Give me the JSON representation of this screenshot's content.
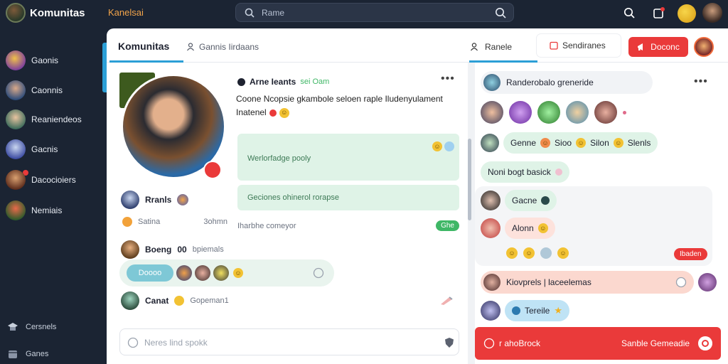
{
  "topbar": {
    "app_name": "Komunitas",
    "subtitle": "Kanelsai",
    "search_value": "Rame"
  },
  "sidebar": {
    "items": [
      {
        "label": "Gaonis"
      },
      {
        "label": "Caonnis"
      },
      {
        "label": "Reaniendeos"
      },
      {
        "label": "Gacnis"
      },
      {
        "label": "Dacocioiers"
      },
      {
        "label": "Nemiais"
      }
    ],
    "footer": [
      {
        "label": "Cersnels",
        "icon": "graduation-cap-icon"
      },
      {
        "label": "Ganes",
        "icon": "box-icon"
      }
    ]
  },
  "tabs": {
    "main": "Komunitas",
    "second": "Gannis Iirdaans",
    "third": "Ranele",
    "fourth": "Sendiranes",
    "action": "Doconc"
  },
  "post": {
    "author": "Arne Ieants",
    "author_meta": "sei Oam",
    "text_line1": "Coone Ncopsie gkambole seloen raple Iludenyulament",
    "text_line2": "Inatenel",
    "card1": "Werlorfadge pooly",
    "card2": "Geciones ohinerol rorapse",
    "footer_meta": "Iharbhe comeyor",
    "footer_badge": "Ghe"
  },
  "profile": {
    "name": "Rranls",
    "stat_label": "Satina",
    "stat_value": "3ohmn"
  },
  "thread": {
    "line1_name": "Boeng",
    "line1_count": "00",
    "line1_meta": "bpiemals",
    "chip_label": "Doooo",
    "line2_name": "Canat",
    "line2_meta": "Gopeman1"
  },
  "composer": {
    "placeholder": "Neres lind spokk"
  },
  "chat": {
    "header": "Randerobalo greneride",
    "bubble_row1": [
      "Genne",
      "Sioo",
      "Silon",
      "Slenls"
    ],
    "bubble_row2": "Noni bogt basick",
    "bubble_row3": "Gacne",
    "bubble_row4": "Alonn",
    "pill_red": "Ibaden",
    "bubble_highlight": "Kiovprels | laceelemas",
    "bubble_blue": "Tereile",
    "footer_left": "r ahoBrock",
    "footer_right": "Sanble Gemeadie"
  },
  "colors": {
    "accent_red": "#ea3a3a",
    "accent_blue": "#2c9fd6",
    "accent_green": "#3fb766",
    "card_green": "#dff3e7",
    "dark_bg": "#1b2433"
  }
}
